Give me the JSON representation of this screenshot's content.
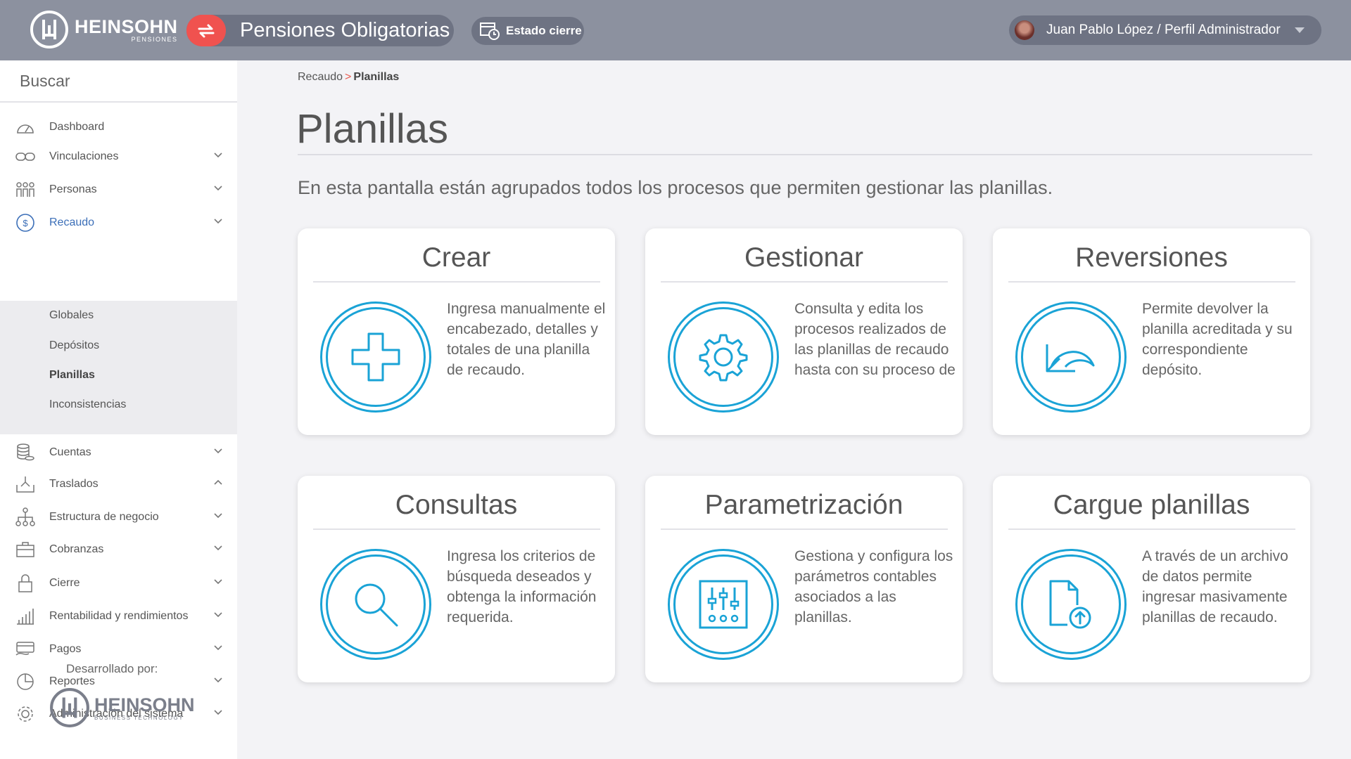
{
  "header": {
    "logo_text": "HEINSOHN",
    "logo_subtext": "PENSIONES",
    "app_title": "Pensiones Obligatorias",
    "estado_label": "Estado cierre",
    "user_label": "Juan Pablo López / Perfil Administrador"
  },
  "sidebar": {
    "search_placeholder": "Buscar",
    "items": [
      {
        "label": "Dashboard",
        "icon": "dashboard-icon"
      },
      {
        "label": "Vinculaciones",
        "icon": "link-icon"
      },
      {
        "label": "Personas",
        "icon": "people-icon"
      },
      {
        "label": "Recaudo",
        "icon": "dollar-icon"
      },
      {
        "label": "Cuentas",
        "icon": "coins-icon"
      },
      {
        "label": "Traslados",
        "icon": "transfer-icon"
      },
      {
        "label": "Estructura de negocio",
        "icon": "hierarchy-icon"
      },
      {
        "label": "Cobranzas",
        "icon": "briefcase-icon"
      },
      {
        "label": "Cierre",
        "icon": "lock-icon"
      },
      {
        "label": "Rentabilidad y rendimientos",
        "icon": "bar-chart-icon"
      },
      {
        "label": "Pagos",
        "icon": "payment-icon"
      },
      {
        "label": "Reportes",
        "icon": "pie-chart-icon"
      },
      {
        "label": "Administración del sistema",
        "icon": "gear-icon"
      }
    ],
    "submenu": [
      "Globales",
      "Depósitos",
      "Planillas",
      "Inconsistencias"
    ],
    "developed_by": "Desarrollado por:",
    "dev_logo_text": "HEINSOHN",
    "dev_logo_subtext": "BUSINESS TECHNOLOGY"
  },
  "breadcrumb": {
    "parent": "Recaudo",
    "separator": ">",
    "current": "Planillas"
  },
  "page": {
    "title": "Planillas",
    "intro": "En esta pantalla están agrupados todos los procesos que permiten gestionar las planillas."
  },
  "cards": [
    {
      "title": "Crear",
      "description": "Ingresa manualmente el encabezado, detalles y totales de una planilla de recaudo.",
      "icon": "plus-icon"
    },
    {
      "title": "Gestionar",
      "description": "Consulta y edita los procesos realizados de las planillas de recaudo hasta con su proceso de",
      "icon": "gear-icon"
    },
    {
      "title": "Reversiones",
      "description": "Permite devolver la planilla acreditada y su correspondiente depósito.",
      "icon": "undo-arrow-icon"
    },
    {
      "title": "Consultas",
      "description": "Ingresa los criterios de búsqueda deseados y obtenga la información requerida.",
      "icon": "search-icon"
    },
    {
      "title": "Parametrización",
      "description": "Gestiona y configura los parámetros contables asociados a las planillas.",
      "icon": "sliders-icon"
    },
    {
      "title": "Cargue planillas",
      "description": "A través de un archivo de datos permite ingresar masivamente planillas de recaudo.",
      "icon": "file-upload-icon"
    }
  ],
  "colors": {
    "accent": "#1aa3d6",
    "topbar": "#8c919f",
    "swap_button": "#f0524f",
    "active_nav": "#3c6fb8"
  }
}
